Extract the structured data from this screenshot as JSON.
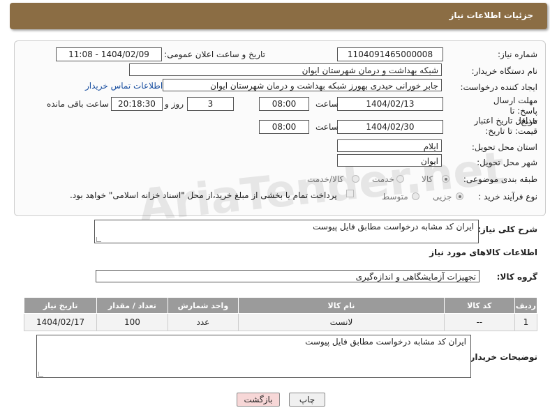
{
  "header": {
    "title": "جزئیات اطلاعات نیاز"
  },
  "fields": {
    "need_number_label": "شماره نیاز:",
    "need_number": "1104091465000008",
    "announce_label": "تاریخ و ساعت اعلان عمومی:",
    "announce_value": "1404/02/09 - 11:08",
    "buyer_org_label": "نام دستگاه خریدار:",
    "buyer_org": "شبکه بهداشت و درمان شهرستان ایوان",
    "creator_label": "ایجاد کننده درخواست:",
    "creator": "جابر خورانی حیدری بهورز شبکه بهداشت و درمان شهرستان ایوان",
    "contact_link": "اطلاعات تماس خریدار",
    "deadline_label": "مهلت ارسال پاسخ: تا تاریخ:",
    "deadline_date": "1404/02/13",
    "time_label": "ساعت",
    "deadline_time": "08:00",
    "days_count": "3",
    "days_label": "روز و",
    "remaining_time": "20:18:30",
    "remaining_label": "ساعت باقی مانده",
    "validity_label": "حداقل تاریخ اعتبار قیمت: تا تاریخ:",
    "validity_date": "1404/02/30",
    "validity_time": "08:00",
    "province_label": "استان محل تحویل:",
    "province": "ایلام",
    "city_label": "شهر محل تحویل:",
    "city": "ایوان",
    "category_label": "طبقه بندی موضوعی:",
    "category_options": [
      "کالا",
      "خدمت",
      "کالا/خدمت"
    ],
    "process_label": "نوع فرآیند خرید :",
    "process_options": [
      "جزیی",
      "متوسط"
    ],
    "payment_note": "پرداخت تمام یا بخشی از مبلغ خرید،از محل \"اسناد خزانه اسلامی\" خواهد بود."
  },
  "description": {
    "label": "شرح کلی نیاز:",
    "value": "ایران کد مشابه درخواست مطابق فایل پیوست"
  },
  "goods_section_title": "اطلاعات کالاهای مورد نیاز",
  "goods_group": {
    "label": "گروه کالا:",
    "value": "تجهیزات آزمایشگاهی و اندازه‌گیری"
  },
  "table": {
    "headers": [
      "ردیف",
      "کد کالا",
      "نام کالا",
      "واحد شمارش",
      "تعداد / مقدار",
      "تاریخ نیاز"
    ],
    "rows": [
      [
        "1",
        "--",
        "لانست",
        "عدد",
        "100",
        "1404/02/17"
      ]
    ]
  },
  "buyer_notes": {
    "label": "توضیحات خریدار:",
    "value": "ایران کد مشابه درخواست مطابق فایل پیوست"
  },
  "buttons": {
    "print": "چاپ",
    "back": "بازگشت"
  },
  "colors": {
    "header_bg": "#8b6d44",
    "table_header_bg": "#9b9b9b",
    "back_button_bg": "#f7d7d7",
    "link": "#1a4fa0"
  }
}
